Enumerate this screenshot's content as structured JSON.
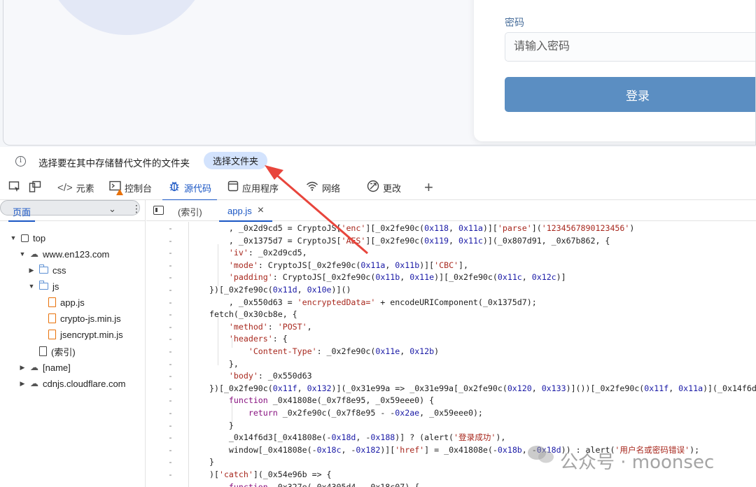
{
  "preview": {
    "password_label": "密码",
    "password_placeholder": "请输入密码",
    "login_button": "登录"
  },
  "infobar": {
    "message": "选择要在其中存储替代文件的文件夹",
    "button": "选择文件夹"
  },
  "devtools_tabs": [
    {
      "label": "元素",
      "icon": "code-icon"
    },
    {
      "label": "控制台",
      "icon": "console-icon"
    },
    {
      "label": "源代码",
      "icon": "bug-icon",
      "active": true
    },
    {
      "label": "应用程序",
      "icon": "application-icon"
    },
    {
      "label": "网络",
      "icon": "wifi-icon"
    },
    {
      "label": "更改",
      "icon": "changes-icon"
    }
  ],
  "navigator": {
    "tab": "页面",
    "tree": [
      {
        "label": "top",
        "icon": "frame",
        "arrow": "down",
        "indent": 0
      },
      {
        "label": "www.en123.com",
        "icon": "cloud",
        "arrow": "down",
        "indent": 1
      },
      {
        "label": "css",
        "icon": "folder",
        "arrow": "right",
        "indent": 2
      },
      {
        "label": "js",
        "icon": "folder",
        "arrow": "down",
        "indent": 2
      },
      {
        "label": "app.js",
        "icon": "file",
        "arrow": "",
        "indent": 3,
        "selected": true
      },
      {
        "label": "crypto-js.min.js",
        "icon": "file",
        "arrow": "",
        "indent": 3
      },
      {
        "label": "jsencrypt.min.js",
        "icon": "file",
        "arrow": "",
        "indent": 3
      },
      {
        "label": "(索引)",
        "icon": "file-gray",
        "arrow": "",
        "indent": 2
      },
      {
        "label": "[name]",
        "icon": "cloud",
        "arrow": "right",
        "indent": 1
      },
      {
        "label": "cdnjs.cloudflare.com",
        "icon": "cloud",
        "arrow": "right",
        "indent": 1
      }
    ]
  },
  "editor": {
    "tabs": [
      "(索引)",
      "app.js"
    ],
    "active_tab": "app.js",
    "lines": [
      "    , _0x2d9cd5 = CryptoJS['enc'][_0x2fe90c(0x118, 0x11a)]['parse']('1234567890123456')",
      "    , _0x1375d7 = CryptoJS['AES'][_0x2fe90c(0x119, 0x11c)](_0x807d91, _0x67b862, {",
      "    'iv': _0x2d9cd5,",
      "    'mode': CryptoJS[_0x2fe90c(0x11a, 0x11b)]['CBC'],",
      "    'padding': CryptoJS[_0x2fe90c(0x11b, 0x11e)][_0x2fe90c(0x11c, 0x12c)]",
      "})[_0x2fe90c(0x11d, 0x10e)]()",
      "    , _0x550d63 = 'encryptedData=' + encodeURIComponent(_0x1375d7);",
      "fetch(_0x30cb8e, {",
      "    'method': 'POST',",
      "    'headers': {",
      "        'Content-Type': _0x2fe90c(0x11e, 0x12b)",
      "    },",
      "    'body': _0x550d63",
      "})[_0x2fe90c(0x11f, 0x132)](_0x31e99a => _0x31e99a[_0x2fe90c(0x120, 0x133)]())[_0x2fe90c(0x11f, 0x11a)](_0x14f6d",
      "    function _0x41808e(_0x7f8e95, _0x59eee0) {",
      "        return _0x2fe90c(_0x7f8e95 - -0x2ae, _0x59eee0);",
      "    }",
      "    _0x14f6d3[_0x41808e(-0x18d, -0x188)] ? (alert('登录成功'),",
      "    window[_0x41808e(-0x18c, -0x182)]['href'] = _0x41808e(-0x18b, -0x18d)) : alert('用户名或密码错误');",
      "}",
      ")['catch'](_0x54e96b => {",
      "    function _0x327e(_0x4305d4, _0x18c07) {"
    ]
  },
  "watermark": "公众号 · moonsec"
}
